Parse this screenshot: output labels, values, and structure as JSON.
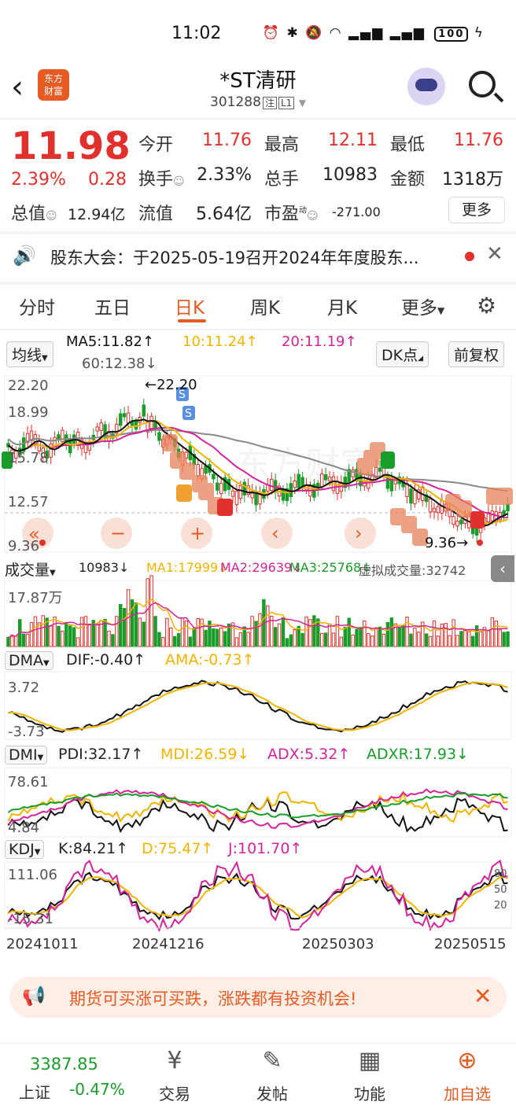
{
  "status": {
    "time": "11:02",
    "battery": "100"
  },
  "header": {
    "logo_text": "东方\n财富",
    "title": "*ST清研",
    "code": "301288",
    "tag1": "注",
    "tag2": "L1"
  },
  "quote": {
    "price": "11.98",
    "change_pct": "2.39%",
    "change": "0.28",
    "open_label": "今开",
    "open": "11.76",
    "high_label": "最高",
    "high": "12.11",
    "low_label": "最低",
    "low": "11.76",
    "turnover_label": "换手",
    "turnover": "2.33%",
    "volume_label": "总手",
    "volume": "10983",
    "amount_label": "金额",
    "amount": "1318万",
    "mktcap_label": "总值",
    "mktcap": "12.94亿",
    "float_label": "流值",
    "float": "5.64亿",
    "pe_label": "市盈",
    "pe_sup": "动",
    "pe": "-271.00",
    "more": "更多"
  },
  "notice": {
    "text": "股东大会：于2025-05-19召开2024年年度股东..."
  },
  "tabs": [
    "分时",
    "五日",
    "日K",
    "周K",
    "月K",
    "更多"
  ],
  "kline": {
    "ma_selector": "均线",
    "ma5": "MA5:11.82↑",
    "ma10": "10:11.24↑",
    "ma20": "20:11.19↑",
    "ma60": "60:12.38↓",
    "dk_button": "DK点",
    "adjust_button": "前复权",
    "y_top": "22.20",
    "y_2": "18.99",
    "y_3": "15.78",
    "y_4": "12.57",
    "y_bottom": "9.36",
    "max_label": "←22.20",
    "min_label": "9.36→",
    "colors": {
      "ma5": "#111111",
      "ma10": "#f0b400",
      "ma20": "#d4249c",
      "ma60": "#777777",
      "up": "#e0312c",
      "down": "#1a9c2a"
    }
  },
  "volume": {
    "selector": "成交量",
    "value": "10983↓",
    "ma1": "MA1:17999↓",
    "ma2": "MA2:29639↓",
    "ma3": "MA3:25768↓",
    "virtual": "虚拟成交量:32742",
    "y_top": "17.87万"
  },
  "dma": {
    "selector": "DMA",
    "dif": "DIF:-0.40↑",
    "ama": "AMA:-0.73↑",
    "y_top": "3.72",
    "y_bottom": "-3.73"
  },
  "dmi": {
    "selector": "DMI",
    "pdi": "PDI:32.17↑",
    "mdi": "MDI:26.59↓",
    "adx": "ADX:5.32↑",
    "adxr": "ADXR:17.93↓",
    "y_top": "78.61",
    "y_bottom": "4.84"
  },
  "kdj": {
    "selector": "KDJ",
    "k": "K:84.21↑",
    "d": "D:75.47↑",
    "j": "J:101.70↑",
    "y_top": "111.06",
    "y_bottom": "-15.31",
    "y_r1": "80",
    "y_r2": "50",
    "y_r3": "20"
  },
  "dates": [
    "20241011",
    "20241216",
    "20250303",
    "20250515"
  ],
  "ad": {
    "text": "期货可买涨可买跌，涨跌都有投资机会!"
  },
  "bottom": {
    "index_value": "3387.85",
    "index_name": "上证",
    "index_change": "-0.47%",
    "nav": [
      "交易",
      "发帖",
      "功能",
      "加自选"
    ]
  }
}
